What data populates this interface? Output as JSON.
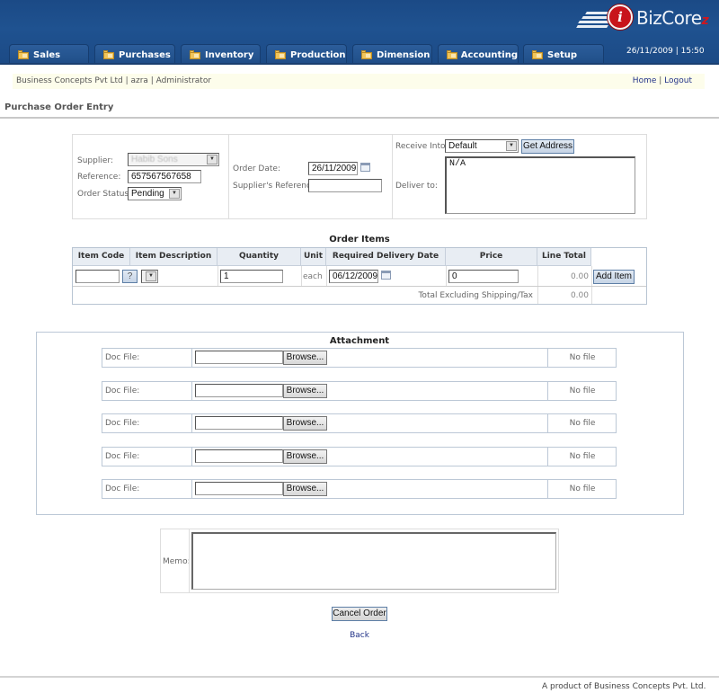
{
  "header": {
    "logo_text": "BizCore",
    "logo_mark": "i",
    "logo_suffix": "z",
    "datetime": "26/11/2009 | 15:50",
    "tabs": [
      {
        "label": "Sales",
        "icon": "folder-icon"
      },
      {
        "label": "Purchases",
        "icon": "folder-icon"
      },
      {
        "label": "Inventory",
        "icon": "folder-icon"
      },
      {
        "label": "Production",
        "icon": "folder-icon"
      },
      {
        "label": "Dimension",
        "icon": "folder-icon"
      },
      {
        "label": "Accounting",
        "icon": "folder-icon"
      },
      {
        "label": "Setup",
        "icon": "folder-icon"
      }
    ]
  },
  "infobar": {
    "company": "Business Concepts Pvt Ltd | azra | Administrator",
    "home_label": "Home",
    "separator": "|",
    "logout_label": "Logout"
  },
  "page_title": "Purchase Order Entry",
  "order_header": {
    "supplier_label": "Supplier:",
    "supplier_value": "Habib Sons",
    "reference_label": "Reference:",
    "reference_value": "657567567658",
    "order_status_label": "Order Status:",
    "order_status_value": "Pending",
    "order_date_label": "Order Date:",
    "order_date_value": "26/11/2009",
    "suppliers_reference_label": "Supplier's Reference:",
    "suppliers_reference_value": "",
    "receive_into_label": "Receive Into:",
    "receive_into_value": "Default",
    "get_address_label": "Get Address",
    "deliver_to_label": "Deliver to:",
    "deliver_to_value": "N/A"
  },
  "order_items": {
    "title": "Order Items",
    "columns": [
      "Item Code",
      "Item Description",
      "Quantity",
      "Unit",
      "Required Delivery Date",
      "Price",
      "Line Total"
    ],
    "row": {
      "item_code": "",
      "lookup_label": "?",
      "quantity": "1",
      "unit": "each",
      "delivery_date": "06/12/2009",
      "price": "0",
      "line_total": "0.00",
      "add_item_label": "Add Item"
    },
    "total_label": "Total Excluding Shipping/Tax",
    "total_value": "0.00"
  },
  "attachments": {
    "title": "Attachment",
    "rows": [
      {
        "label": "Doc File:",
        "browse_label": "Browse...",
        "status": "No file"
      },
      {
        "label": "Doc File:",
        "browse_label": "Browse...",
        "status": "No file"
      },
      {
        "label": "Doc File:",
        "browse_label": "Browse...",
        "status": "No file"
      },
      {
        "label": "Doc File:",
        "browse_label": "Browse...",
        "status": "No file"
      },
      {
        "label": "Doc File:",
        "browse_label": "Browse...",
        "status": "No file"
      }
    ]
  },
  "memo": {
    "label": "Memo:",
    "value": ""
  },
  "actions": {
    "cancel_order_label": "Cancel Order",
    "back_label": "Back"
  },
  "footer": {
    "text": "A product of Business Concepts Pvt. Ltd."
  }
}
